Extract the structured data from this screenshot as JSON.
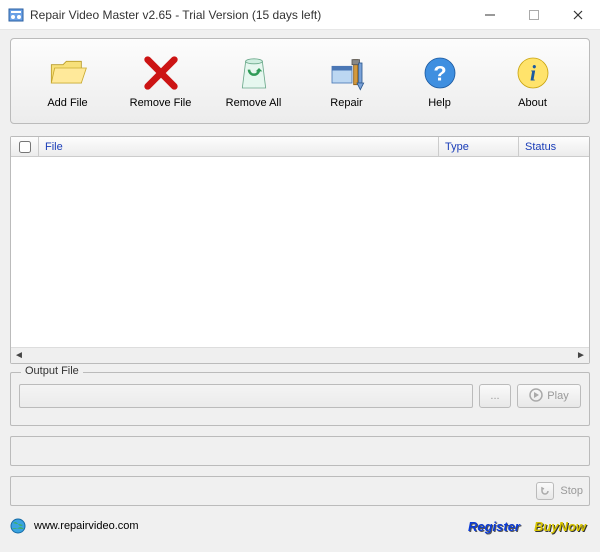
{
  "window": {
    "title": "Repair Video Master v2.65 - Trial Version (15 days left)"
  },
  "toolbar": {
    "items": [
      {
        "label": "Add File"
      },
      {
        "label": "Remove File"
      },
      {
        "label": "Remove All"
      },
      {
        "label": "Repair"
      },
      {
        "label": "Help"
      },
      {
        "label": "About"
      }
    ]
  },
  "columns": {
    "file": "File",
    "type": "Type",
    "status": "Status"
  },
  "output": {
    "legend": "Output File",
    "browse_label": "...",
    "play_label": "Play"
  },
  "stop_label": "Stop",
  "footer": {
    "url": "www.repairvideo.com",
    "register": "Register",
    "buynow": "BuyNow"
  }
}
